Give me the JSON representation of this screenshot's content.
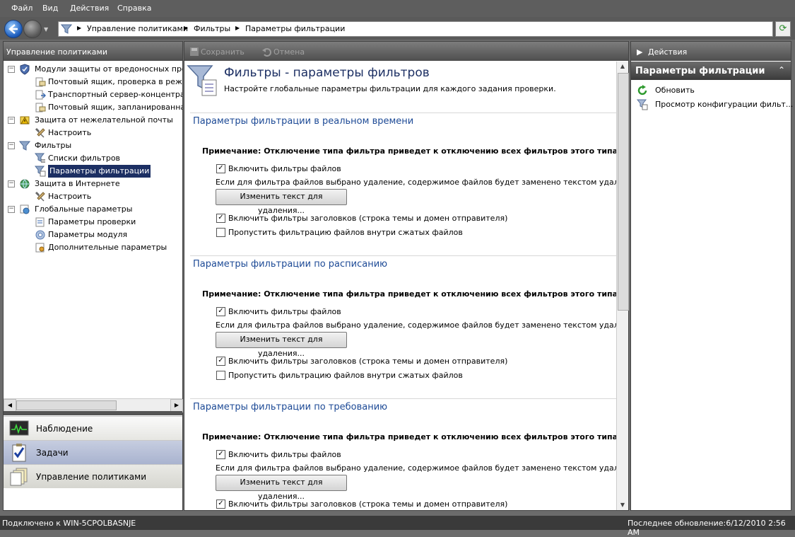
{
  "menu": [
    "Файл",
    "Вид",
    "Действия",
    "Справка"
  ],
  "breadcrumb": [
    "Управление политиками",
    "Фильтры",
    "Параметры фильтрации"
  ],
  "left_panel": {
    "title": "Управление политиками",
    "tree": [
      {
        "label": "Модули защиты от вредоносных про",
        "level": 0,
        "expanded": true,
        "icon": "shield-icon"
      },
      {
        "label": "Почтовый ящик, проверка в режи",
        "level": 1,
        "icon": "mailbox-icon"
      },
      {
        "label": "Транспортный сервер-концентрат",
        "level": 1,
        "icon": "transport-icon"
      },
      {
        "label": "Почтовый ящик, запланированна",
        "level": 1,
        "icon": "mailbox-icon"
      },
      {
        "label": "Защита от нежелательной почты",
        "level": 0,
        "expanded": true,
        "icon": "spam-shield-icon"
      },
      {
        "label": "Настроить",
        "level": 1,
        "icon": "tools-icon"
      },
      {
        "label": "Фильтры",
        "level": 0,
        "expanded": true,
        "icon": "filter-icon"
      },
      {
        "label": "Списки фильтров",
        "level": 1,
        "icon": "filter-list-icon"
      },
      {
        "label": "Параметры фильтрации",
        "level": 1,
        "selected": true,
        "icon": "filter-settings-icon"
      },
      {
        "label": "Защита в Интернете",
        "level": 0,
        "expanded": true,
        "icon": "globe-shield-icon"
      },
      {
        "label": "Настроить",
        "level": 1,
        "icon": "tools-icon"
      },
      {
        "label": "Глобальные параметры",
        "level": 0,
        "expanded": true,
        "icon": "global-settings-icon"
      },
      {
        "label": "Параметры проверки",
        "level": 1,
        "icon": "scan-settings-icon"
      },
      {
        "label": "Параметры модуля",
        "level": 1,
        "icon": "module-settings-icon"
      },
      {
        "label": "Дополнительные параметры",
        "level": 1,
        "icon": "advanced-settings-icon"
      }
    ],
    "workspace_buttons": [
      {
        "label": "Наблюдение",
        "icon": "monitor-icon"
      },
      {
        "label": "Задачи",
        "icon": "tasks-icon"
      },
      {
        "label": "Управление политиками",
        "icon": "policy-icon"
      }
    ]
  },
  "toolbar": {
    "save": "Сохранить",
    "cancel": "Отмена"
  },
  "content": {
    "title": "Фильтры - параметры фильтров",
    "subtitle": "Настройте глобальные параметры фильтрации для каждого задания проверки.",
    "sections": [
      {
        "heading": "Параметры фильтрации в реальном времени",
        "note": "Примечание:  Отключение типа фильтра приведет к отключению всех фильтров этого типа для задания с",
        "enable_file_filters": {
          "label": "Включить фильтры файлов",
          "checked": true
        },
        "info": "Если для фильтра файлов выбрано удаление, содержимое файлов будет заменено текстом удаления.",
        "button": "Изменить текст для удаления...",
        "enable_header_filters": {
          "label": "Включить фильтры заголовков (строка темы и домен отправителя)",
          "checked": true
        },
        "skip_compressed": {
          "label": "Пропустить фильтрацию файлов внутри сжатых файлов",
          "checked": false
        }
      },
      {
        "heading": "Параметры фильтрации по расписанию",
        "note": "Примечание:  Отключение типа фильтра приведет к отключению всех фильтров этого типа для задания с",
        "enable_file_filters": {
          "label": "Включить фильтры файлов",
          "checked": true
        },
        "info": "Если для фильтра файлов выбрано удаление, содержимое файлов будет заменено текстом удаления.",
        "button": "Изменить текст для удаления...",
        "enable_header_filters": {
          "label": "Включить фильтры заголовков (строка темы и домен отправителя)",
          "checked": true
        },
        "skip_compressed": {
          "label": "Пропустить фильтрацию файлов внутри сжатых файлов",
          "checked": false
        }
      },
      {
        "heading": "Параметры фильтрации по требованию",
        "note": "Примечание:  Отключение типа фильтра приведет к отключению всех фильтров этого типа для задания с",
        "enable_file_filters": {
          "label": "Включить фильтры файлов",
          "checked": true
        },
        "info": "Если для фильтра файлов выбрано удаление, содержимое файлов будет заменено текстом удаления.",
        "button": "Изменить текст для удаления...",
        "enable_header_filters": {
          "label": "Включить фильтры заголовков (строка темы и домен отправителя)",
          "checked": true
        }
      }
    ]
  },
  "right_panel": {
    "header": "Действия",
    "section_title": "Параметры фильтрации",
    "actions": [
      {
        "label": "Обновить",
        "icon": "refresh-icon"
      },
      {
        "label": "Просмотр конфигурации фильт...",
        "icon": "view-config-icon"
      }
    ]
  },
  "status": {
    "left": "Подключено к WIN-5CPOLBASNJE",
    "right": "Последнее обновление:6/12/2010 2:56 AM"
  },
  "colors": {
    "accent": "#1c2f63",
    "section_heading": "#1d4a96"
  }
}
